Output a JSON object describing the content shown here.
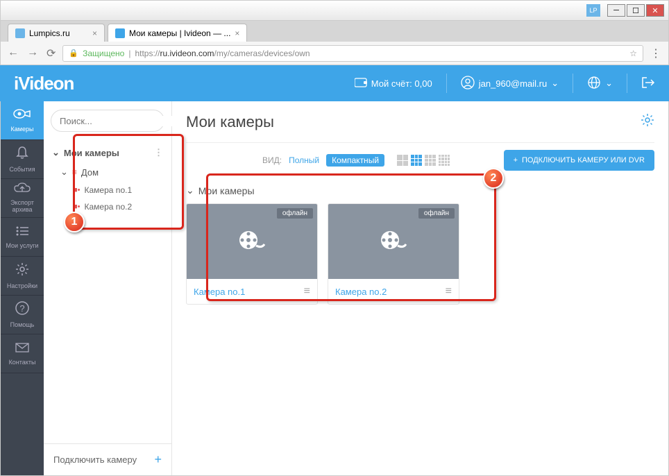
{
  "window": {
    "lp_badge": "LP"
  },
  "tabs": [
    {
      "title": "Lumpics.ru",
      "favicon_color": "#6bb5e8"
    },
    {
      "title": "Мои камеры | Ivideon — ...",
      "favicon_color": "#3ea5e8"
    }
  ],
  "addressbar": {
    "secure_label": "Защищено",
    "url_prefix": "https://",
    "url_host": "ru.ivideon.com",
    "url_path": "/my/cameras/devices/own"
  },
  "header": {
    "logo": "iVideon",
    "balance_label": "Мой счёт: 0,00",
    "user_email": "jan_960@mail.ru"
  },
  "leftnav": [
    {
      "label": "Камеры",
      "icon": "👁"
    },
    {
      "label": "События",
      "icon": "🔔"
    },
    {
      "label": "Экспорт архива",
      "icon": "☁"
    },
    {
      "label": "Мои услуги",
      "icon": "≣"
    },
    {
      "label": "Настройки",
      "icon": "⚙"
    },
    {
      "label": "Помощь",
      "icon": "?"
    },
    {
      "label": "Контакты",
      "icon": "✉"
    }
  ],
  "search": {
    "placeholder": "Поиск..."
  },
  "tree": {
    "root": "Мои камеры",
    "group": "Дом",
    "cameras": [
      "Камера no.1",
      "Камера no.2"
    ],
    "footer": "Подключить камеру"
  },
  "content": {
    "title": "Мои камеры",
    "view_label": "ВИД:",
    "view_full": "Полный",
    "view_compact": "Компактный",
    "connect_btn": "ПОДКЛЮЧИТЬ КАМЕРУ ИЛИ DVR",
    "section": "Мои камеры",
    "cards": [
      {
        "name": "Камера no.1",
        "status": "офлайн"
      },
      {
        "name": "Камера no.2",
        "status": "офлайн"
      }
    ]
  },
  "annotations": {
    "badge1": "1",
    "badge2": "2"
  }
}
